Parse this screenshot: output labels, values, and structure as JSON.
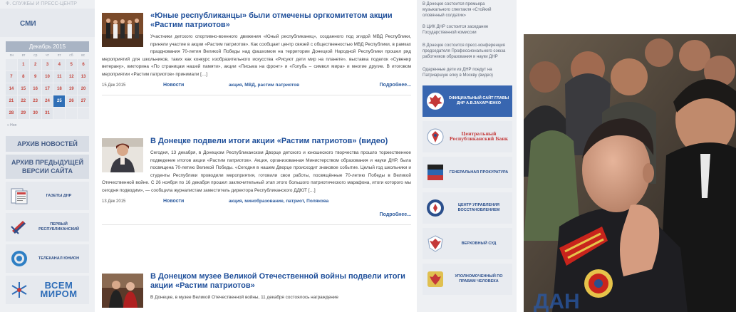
{
  "sidebar": {
    "top_cut_text": "Ф. СЛУЖБЫ И ПРЕСС-ЦЕНТР",
    "smi_label": "СМИ",
    "calendar": {
      "month": "Декабрь 2015",
      "weekdays": [
        "пн",
        "вт",
        "ср",
        "чт",
        "пт",
        "сб",
        "вс"
      ],
      "days": [
        "",
        "1",
        "2",
        "3",
        "4",
        "5",
        "6",
        "7",
        "8",
        "9",
        "10",
        "11",
        "12",
        "13",
        "14",
        "15",
        "16",
        "17",
        "18",
        "19",
        "20",
        "21",
        "22",
        "23",
        "24",
        "25",
        "26",
        "27",
        "28",
        "29",
        "30",
        "31",
        "",
        "",
        ""
      ],
      "today": "25",
      "nav_prev": "« Ноя"
    },
    "archive_news": "АРХИВ НОВОСТЕЙ",
    "archive_prev": "АРХИВ ПРЕДЫДУЩЕЙ ВЕРСИИ САЙТА",
    "banners": [
      {
        "icon": "newspaper-icon",
        "text": "ГАЗЕТЫ ДНР"
      },
      {
        "icon": "first-channel-icon",
        "text": "ПЕРВЫЙ РЕСПУБЛИКАНСКИЙ"
      },
      {
        "icon": "tv-union-icon",
        "text": "ТЕЛЕКАНАЛ ЮНИОН"
      },
      {
        "icon": "snowflake-icon",
        "text": "ВСЕМ МИРОМ"
      }
    ]
  },
  "articles": [
    {
      "title": "«Юные республиканцы» были отмечены оргкомитетом акции «Растим патриотов»",
      "body": "Участники детского спортивно-военного движения «Юный республиканец», созданного под эгидой МВД Республики, приняли участие в акции «Растим патриотов». Как сообщает центр связей с общественностью МВД Республики, в рамках празднования 70-летия Великой Победы над фашизмом на территории Донецкой Народной Республики прошел ряд мероприятий для школьников, таких как конкурс изобразительного искусства «Рисуют дети мир на планете», выставка поделок «Сувенир ветерану», викторина «По страницам нашей памяти», акции «Письма на фронт» и «Голубь – символ мира» и многие другие. В итоговом мероприятии «Растим патриотов» принимали […]",
      "date": "15 Дек 2015",
      "category": "Новости",
      "tags": "акция, МВД, растим патриотов",
      "more": "Подробнее..."
    },
    {
      "title": "В Донецке подвели итоги акции «Растим патриотов» (видео)",
      "body": "Сегодня, 13 декабря, в Донецком Республиканском Дворце детского и юношеского творчества прошло торжественное подведение итогов акции «Растим патриотов». Акция, организованная Министерством образования и науки ДНР, была посвящена 70-летию Великой Победы. «Сегодня в нашем Дворце происходит знаковое событие. Целый год школьники и студенты Республики проводили мероприятия, готовили свои работы, посвящённые 70-летию Победы в Великой Отечественной войне. С 26 ноября по 16 декабря прошел заключительный этап этого большого патриотического марафона, итоги которого мы сегодня подводим», — сообщила журналистам заместитель директора Республиканского ДДЮТ […]",
      "date": "13 Дек 2015",
      "category": "Новости",
      "tags": "акция, минобразование, патриот, Полякова",
      "more": "Подробнее..."
    },
    {
      "title": "В Донецком музее Великой Отечественной войны подвели итоги акции «Растим патриотов»",
      "body": "В Донецке, в музее Великой Отечественной войны, 11 декабря состоялось награждение"
    }
  ],
  "right_col": {
    "news": [
      "В Донецке состоится премьера музыкального спектакля «Стойкий оловянный солдатик»",
      "В ЦИК ДНР состоится заседание Государственной комиссии",
      "В Донецке состоится пресс-конференция председателя Профессионального союза работников образования и науки ДНР",
      "Одаренные дети из ДНР поедут на Патриаршую елку в Москву (видео)"
    ],
    "banners": [
      {
        "icon": "dnr-emblem-icon",
        "text": "ОФИЦИАЛЬНЫЙ САЙТ ГЛАВЫ ДНР А.В.ЗАХАРЧЕНКО",
        "style": "blue"
      },
      {
        "icon": "bank-emblem-icon",
        "text": "Центральный Республиканский Банк",
        "style": "red"
      },
      {
        "icon": "prosecutor-icon",
        "text": "ГЕНЕРАЛЬНАЯ ПРОКУРАТУРА",
        "style": "plain"
      },
      {
        "icon": "restoration-icon",
        "text": "ЦЕНТР УПРАВЛЕНИЯ ВОССТАНОВЛЕНИЕМ",
        "style": "plain"
      },
      {
        "icon": "court-emblem-icon",
        "text": "ВЕРХОВНЫЙ СУД",
        "style": "plain"
      },
      {
        "icon": "ombudsman-icon",
        "text": "УПОЛНОМОЧЕННЫЙ ПО ПРАВАМ ЧЕЛОВЕКА",
        "style": "plain"
      }
    ]
  },
  "photo": {
    "watermark": "ДАН"
  },
  "colors": {
    "accent_blue": "#1f4f9a",
    "calendar_red": "#c4433a",
    "today_blue": "#2f6fb6",
    "banner_blue": "#3866b0"
  }
}
